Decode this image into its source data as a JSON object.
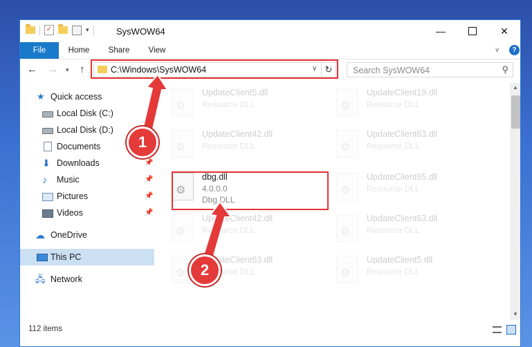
{
  "window": {
    "title": "SysWOW64"
  },
  "ribbon": {
    "tabs": [
      "File",
      "Home",
      "Share",
      "View"
    ],
    "help": "?"
  },
  "nav": {
    "address": "C:\\Windows\\SysWOW64",
    "search_placeholder": "Search SysWOW64"
  },
  "sidebar": {
    "items": [
      {
        "label": "Quick access",
        "icon": "star-icon"
      },
      {
        "label": "Local Disk (C:)",
        "icon": "drive-icon"
      },
      {
        "label": "Local Disk (D:)",
        "icon": "drive-icon"
      },
      {
        "label": "Documents",
        "icon": "documents-icon"
      },
      {
        "label": "Downloads",
        "icon": "downloads-icon"
      },
      {
        "label": "Music",
        "icon": "music-icon"
      },
      {
        "label": "Pictures",
        "icon": "pictures-icon"
      },
      {
        "label": "Videos",
        "icon": "videos-icon"
      },
      {
        "label": "OneDrive",
        "icon": "cloud-icon"
      },
      {
        "label": "This PC",
        "icon": "computer-icon"
      },
      {
        "label": "Network",
        "icon": "network-icon"
      }
    ]
  },
  "files": [
    {
      "name": "UpdateClient5.dll",
      "desc": "Resource DLL"
    },
    {
      "name": "UpdateClient19.dll",
      "desc": "Resource DLL"
    },
    {
      "name": "UpdateClient42.dll",
      "desc": "Resource DLL"
    },
    {
      "name": "UpdateClient63.dll",
      "desc": "Resource DLL"
    },
    {
      "name": "dbg.dll",
      "version": "4.0.0.0",
      "desc": "Dbg DLL"
    },
    {
      "name": "UpdateClient65.dll",
      "desc": "Resource DLL"
    },
    {
      "name": "UpdateClient42.dll",
      "desc": "Resource DLL"
    },
    {
      "name": "UpdateClient63.dll",
      "desc": "Resource DLL"
    },
    {
      "name": "UpdateClient63.dll",
      "desc": "Resource DLL"
    },
    {
      "name": "UpdateClient5.dll",
      "desc": "Resource DLL"
    }
  ],
  "status": {
    "count": "112 items"
  },
  "annotations": {
    "step1": "1",
    "step2": "2",
    "color": "#e53a3a"
  }
}
